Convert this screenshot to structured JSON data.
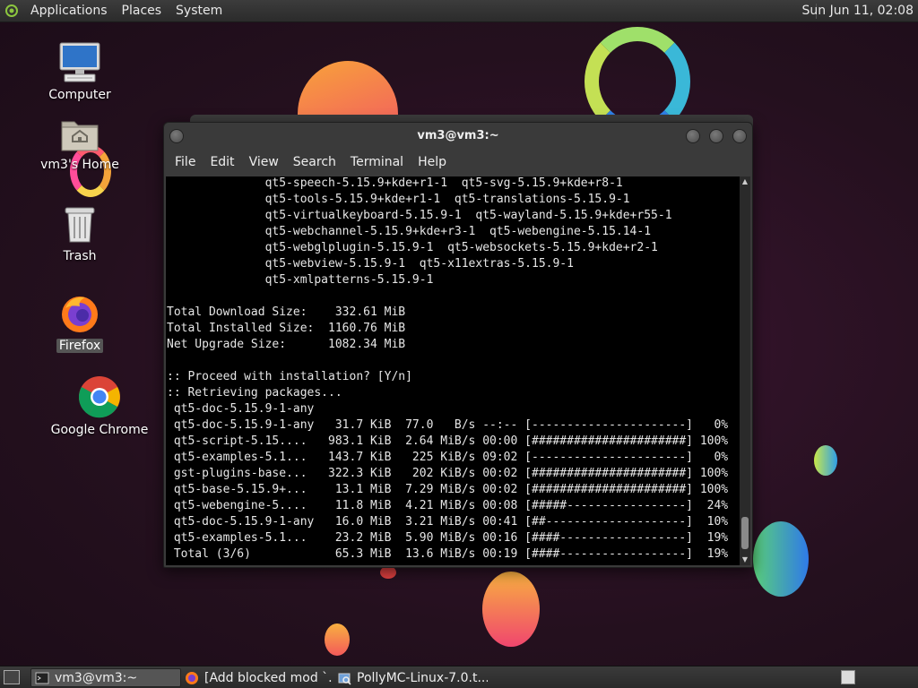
{
  "top_panel": {
    "menus": [
      "Applications",
      "Places",
      "System"
    ],
    "clock": "Sun Jun 11, 02:08"
  },
  "desktop_icons": [
    {
      "label": "Computer",
      "icon": "computer-icon"
    },
    {
      "label": "vm3's Home",
      "icon": "home-folder-icon"
    },
    {
      "label": "Trash",
      "icon": "trash-icon"
    },
    {
      "label": "Firefox",
      "icon": "firefox-icon"
    },
    {
      "label": "Google Chrome",
      "icon": "chrome-icon"
    }
  ],
  "terminal": {
    "title": "vm3@vm3:~",
    "menus": [
      "File",
      "Edit",
      "View",
      "Search",
      "Terminal",
      "Help"
    ],
    "lines": [
      "              qt5-speech-5.15.9+kde+r1-1  qt5-svg-5.15.9+kde+r8-1",
      "              qt5-tools-5.15.9+kde+r1-1  qt5-translations-5.15.9-1",
      "              qt5-virtualkeyboard-5.15.9-1  qt5-wayland-5.15.9+kde+r55-1",
      "              qt5-webchannel-5.15.9+kde+r3-1  qt5-webengine-5.15.14-1",
      "              qt5-webglplugin-5.15.9-1  qt5-websockets-5.15.9+kde+r2-1",
      "              qt5-webview-5.15.9-1  qt5-x11extras-5.15.9-1",
      "              qt5-xmlpatterns-5.15.9-1",
      "",
      "Total Download Size:    332.61 MiB",
      "Total Installed Size:  1160.76 MiB",
      "Net Upgrade Size:      1082.34 MiB",
      "",
      ":: Proceed with installation? [Y/n]",
      ":: Retrieving packages...",
      " qt5-doc-5.15.9-1-any",
      " qt5-doc-5.15.9-1-any   31.7 KiB  77.0   B/s --:-- [----------------------]   0%",
      " qt5-script-5.15....   983.1 KiB  2.64 MiB/s 00:00 [######################] 100%",
      " qt5-examples-5.1...   143.7 KiB   225 KiB/s 09:02 [----------------------]   0%",
      " gst-plugins-base...   322.3 KiB   202 KiB/s 00:02 [######################] 100%",
      " qt5-base-5.15.9+...    13.1 MiB  7.29 MiB/s 00:02 [######################] 100%",
      " qt5-webengine-5....    11.8 MiB  4.21 MiB/s 00:08 [#####-----------------]  24%",
      " qt5-doc-5.15.9-1-any   16.0 MiB  3.21 MiB/s 00:41 [##--------------------]  10%",
      " qt5-examples-5.1...    23.2 MiB  5.90 MiB/s 00:16 [####------------------]  19%",
      " Total (3/6)            65.3 MiB  13.6 MiB/s 00:19 [####------------------]  19%"
    ]
  },
  "taskbar": {
    "tasks": [
      {
        "label": "vm3@vm3:~",
        "icon": "terminal-icon",
        "active": true
      },
      {
        "label": "[Add blocked mod `...",
        "icon": "firefox-icon",
        "active": false
      },
      {
        "label": "PollyMC-Linux-7.0.t...",
        "icon": "file-manager-icon",
        "active": false
      }
    ]
  }
}
